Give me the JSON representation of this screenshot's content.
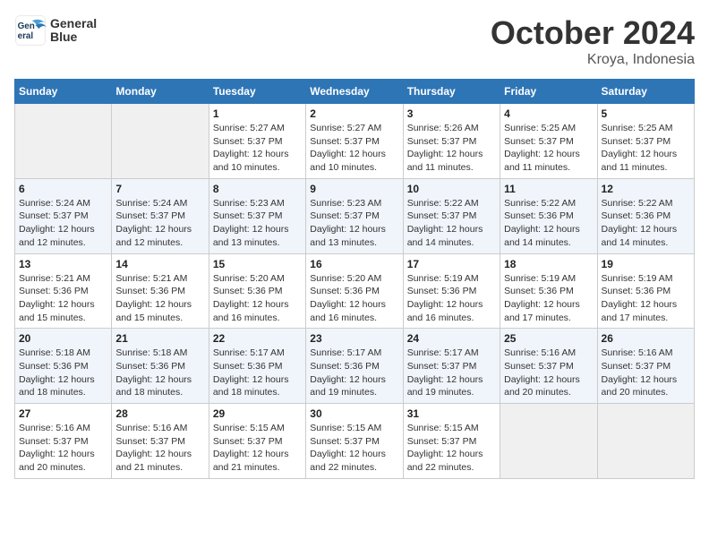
{
  "logo": {
    "line1": "General",
    "line2": "Blue"
  },
  "title": "October 2024",
  "location": "Kroya, Indonesia",
  "days_header": [
    "Sunday",
    "Monday",
    "Tuesday",
    "Wednesday",
    "Thursday",
    "Friday",
    "Saturday"
  ],
  "weeks": [
    {
      "days": [
        {
          "num": "",
          "info": ""
        },
        {
          "num": "",
          "info": ""
        },
        {
          "num": "1",
          "info": "Sunrise: 5:27 AM\nSunset: 5:37 PM\nDaylight: 12 hours and 10 minutes."
        },
        {
          "num": "2",
          "info": "Sunrise: 5:27 AM\nSunset: 5:37 PM\nDaylight: 12 hours and 10 minutes."
        },
        {
          "num": "3",
          "info": "Sunrise: 5:26 AM\nSunset: 5:37 PM\nDaylight: 12 hours and 11 minutes."
        },
        {
          "num": "4",
          "info": "Sunrise: 5:25 AM\nSunset: 5:37 PM\nDaylight: 12 hours and 11 minutes."
        },
        {
          "num": "5",
          "info": "Sunrise: 5:25 AM\nSunset: 5:37 PM\nDaylight: 12 hours and 11 minutes."
        }
      ]
    },
    {
      "days": [
        {
          "num": "6",
          "info": "Sunrise: 5:24 AM\nSunset: 5:37 PM\nDaylight: 12 hours and 12 minutes."
        },
        {
          "num": "7",
          "info": "Sunrise: 5:24 AM\nSunset: 5:37 PM\nDaylight: 12 hours and 12 minutes."
        },
        {
          "num": "8",
          "info": "Sunrise: 5:23 AM\nSunset: 5:37 PM\nDaylight: 12 hours and 13 minutes."
        },
        {
          "num": "9",
          "info": "Sunrise: 5:23 AM\nSunset: 5:37 PM\nDaylight: 12 hours and 13 minutes."
        },
        {
          "num": "10",
          "info": "Sunrise: 5:22 AM\nSunset: 5:37 PM\nDaylight: 12 hours and 14 minutes."
        },
        {
          "num": "11",
          "info": "Sunrise: 5:22 AM\nSunset: 5:36 PM\nDaylight: 12 hours and 14 minutes."
        },
        {
          "num": "12",
          "info": "Sunrise: 5:22 AM\nSunset: 5:36 PM\nDaylight: 12 hours and 14 minutes."
        }
      ]
    },
    {
      "days": [
        {
          "num": "13",
          "info": "Sunrise: 5:21 AM\nSunset: 5:36 PM\nDaylight: 12 hours and 15 minutes."
        },
        {
          "num": "14",
          "info": "Sunrise: 5:21 AM\nSunset: 5:36 PM\nDaylight: 12 hours and 15 minutes."
        },
        {
          "num": "15",
          "info": "Sunrise: 5:20 AM\nSunset: 5:36 PM\nDaylight: 12 hours and 16 minutes."
        },
        {
          "num": "16",
          "info": "Sunrise: 5:20 AM\nSunset: 5:36 PM\nDaylight: 12 hours and 16 minutes."
        },
        {
          "num": "17",
          "info": "Sunrise: 5:19 AM\nSunset: 5:36 PM\nDaylight: 12 hours and 16 minutes."
        },
        {
          "num": "18",
          "info": "Sunrise: 5:19 AM\nSunset: 5:36 PM\nDaylight: 12 hours and 17 minutes."
        },
        {
          "num": "19",
          "info": "Sunrise: 5:19 AM\nSunset: 5:36 PM\nDaylight: 12 hours and 17 minutes."
        }
      ]
    },
    {
      "days": [
        {
          "num": "20",
          "info": "Sunrise: 5:18 AM\nSunset: 5:36 PM\nDaylight: 12 hours and 18 minutes."
        },
        {
          "num": "21",
          "info": "Sunrise: 5:18 AM\nSunset: 5:36 PM\nDaylight: 12 hours and 18 minutes."
        },
        {
          "num": "22",
          "info": "Sunrise: 5:17 AM\nSunset: 5:36 PM\nDaylight: 12 hours and 18 minutes."
        },
        {
          "num": "23",
          "info": "Sunrise: 5:17 AM\nSunset: 5:36 PM\nDaylight: 12 hours and 19 minutes."
        },
        {
          "num": "24",
          "info": "Sunrise: 5:17 AM\nSunset: 5:37 PM\nDaylight: 12 hours and 19 minutes."
        },
        {
          "num": "25",
          "info": "Sunrise: 5:16 AM\nSunset: 5:37 PM\nDaylight: 12 hours and 20 minutes."
        },
        {
          "num": "26",
          "info": "Sunrise: 5:16 AM\nSunset: 5:37 PM\nDaylight: 12 hours and 20 minutes."
        }
      ]
    },
    {
      "days": [
        {
          "num": "27",
          "info": "Sunrise: 5:16 AM\nSunset: 5:37 PM\nDaylight: 12 hours and 20 minutes."
        },
        {
          "num": "28",
          "info": "Sunrise: 5:16 AM\nSunset: 5:37 PM\nDaylight: 12 hours and 21 minutes."
        },
        {
          "num": "29",
          "info": "Sunrise: 5:15 AM\nSunset: 5:37 PM\nDaylight: 12 hours and 21 minutes."
        },
        {
          "num": "30",
          "info": "Sunrise: 5:15 AM\nSunset: 5:37 PM\nDaylight: 12 hours and 22 minutes."
        },
        {
          "num": "31",
          "info": "Sunrise: 5:15 AM\nSunset: 5:37 PM\nDaylight: 12 hours and 22 minutes."
        },
        {
          "num": "",
          "info": ""
        },
        {
          "num": "",
          "info": ""
        }
      ]
    }
  ]
}
